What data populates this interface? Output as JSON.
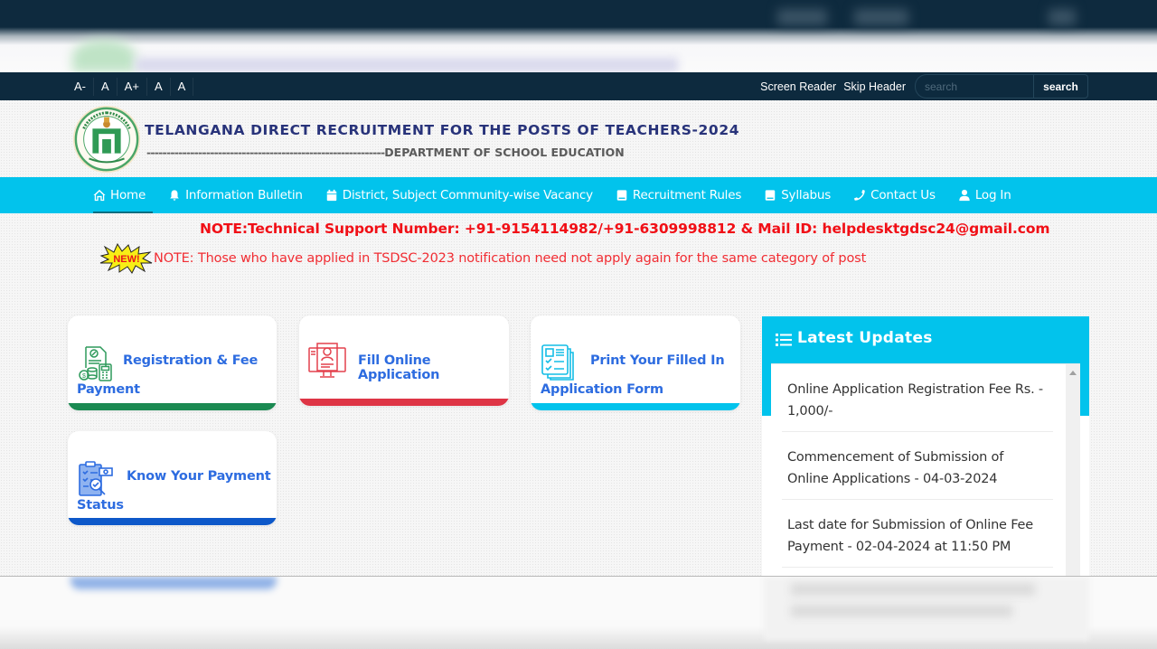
{
  "topbar": {
    "font_controls": [
      "A-",
      "A",
      "A+",
      "A",
      "A"
    ],
    "screen_reader": "Screen Reader",
    "skip_header": "Skip Header",
    "search_placeholder": "search",
    "search_value": "",
    "search_button": "search"
  },
  "header": {
    "logo_icon": "telangana-government-emblem",
    "title": "TELANGANA DIRECT RECRUITMENT FOR THE POSTS OF TEACHERS-2024",
    "subtitle_dashes": "------------------------------------------------------------",
    "subtitle": "DEPARTMENT OF SCHOOL EDUCATION"
  },
  "nav": {
    "items": [
      {
        "label": "Home",
        "icon": "home-icon",
        "active": true
      },
      {
        "label": "Information Bulletin",
        "icon": "bell-icon"
      },
      {
        "label": "District, Subject Community-wise Vacancy",
        "icon": "calendar-icon"
      },
      {
        "label": "Recruitment Rules",
        "icon": "book-icon"
      },
      {
        "label": "Syllabus",
        "icon": "book-icon"
      },
      {
        "label": "Contact Us",
        "icon": "phone-icon"
      },
      {
        "label": "Log In",
        "icon": "user-icon"
      }
    ]
  },
  "notes": {
    "support": "NOTE:Technical Support Number: +91-9154114982/+91-6309998812 & Mail ID: helpdesktgdsc24@gmail.com",
    "new_badge": "NEW!",
    "notice": "NOTE: Those who have applied in TSDSC-2023 notification need not apply again for the same category of post"
  },
  "cards": [
    {
      "line1": "Registration & Fee",
      "line2": "Payment",
      "icon": "fee-payment-icon",
      "accent": "#1b8a52"
    },
    {
      "line1": "Fill Online Application",
      "line2": "",
      "icon": "online-application-icon",
      "accent": "#de3545"
    },
    {
      "line1": "Print Your Filled In",
      "line2": "Application Form",
      "icon": "print-form-icon",
      "accent": "#02c3ec"
    },
    {
      "line1": "Know Your Payment",
      "line2": "Status",
      "icon": "payment-status-icon",
      "accent": "#0d58c9"
    }
  ],
  "updates": {
    "title": "Latest Updates",
    "items": [
      "Online Application Registration Fee Rs. - 1,000/-",
      "Commencement of Submission of Online Applications - 04-03-2024",
      "Last date for Submission of Online Fee Payment - 02-04-2024 at 11:50 PM"
    ]
  },
  "colors": {
    "topbar": "#0d2a3e",
    "nav": "#02c3ec",
    "title": "#28337a",
    "note": "#f10f16",
    "card_text": "#2d6ce0"
  }
}
